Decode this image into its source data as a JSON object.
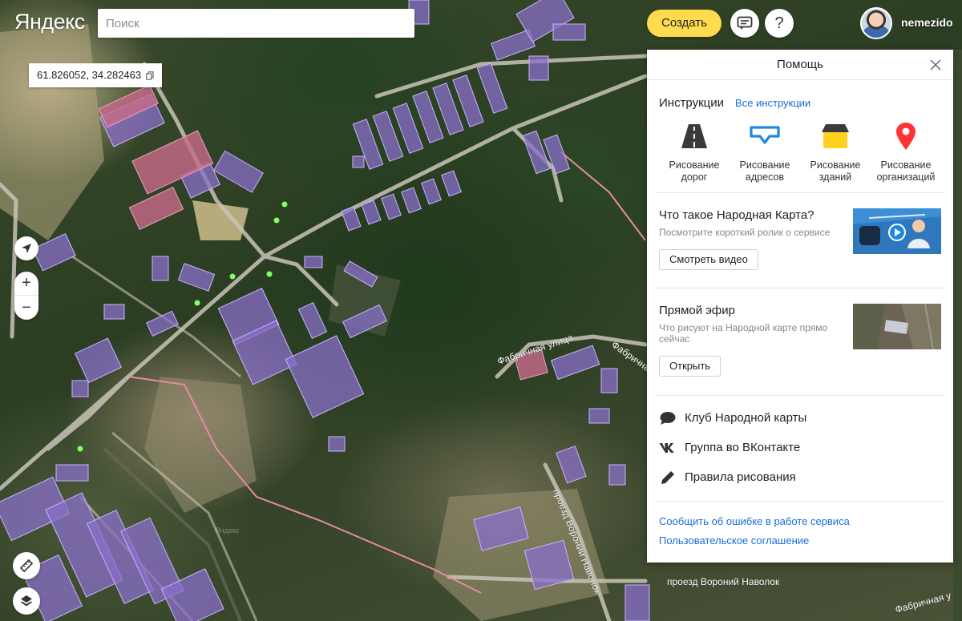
{
  "header": {
    "logo": "Яндекс",
    "search_placeholder": "Поиск",
    "create_label": "Создать",
    "help_label": "?",
    "username": "nemezido"
  },
  "coordinates": {
    "value": "61.826052, 34.282463"
  },
  "zoom": {
    "plus": "+",
    "minus": "−"
  },
  "map_labels": {
    "street_fabrichnaya_1": "Фабричная улица",
    "street_fabrichnaya_2": "Фабричная",
    "street_fabrichnaya_3": "Фабричная у",
    "proezd_vertical": "проезд Вороний Наволок",
    "proezd_horizontal": "проезд Вороний Наволок",
    "watermark": "Яндекс"
  },
  "help_panel": {
    "title": "Помощь",
    "instructions": {
      "title": "Инструкции",
      "all_link": "Все инструкции",
      "tools": [
        {
          "icon": "road-icon",
          "line1": "Рисование",
          "line2": "дорог"
        },
        {
          "icon": "address-icon",
          "line1": "Рисование",
          "line2": "адресов"
        },
        {
          "icon": "building-icon",
          "line1": "Рисование",
          "line2": "зданий"
        },
        {
          "icon": "pin-icon",
          "line1": "Рисование",
          "line2": "организаций"
        }
      ]
    },
    "video_card": {
      "title": "Что такое Народная Карта?",
      "subtitle": "Посмотрите короткий ролик о сервисе",
      "button": "Смотреть видео"
    },
    "live_card": {
      "title": "Прямой эфир",
      "subtitle": "Что рисуют на Народной карте прямо сейчас",
      "button": "Открыть"
    },
    "links": [
      {
        "icon": "chat-icon",
        "label": "Клуб Народной карты"
      },
      {
        "icon": "vk-icon",
        "label": "Группа во ВКонтакте"
      },
      {
        "icon": "pencil-icon",
        "label": "Правила рисования"
      }
    ],
    "footer": {
      "report": "Сообщить об ошибке в работе сервиса",
      "agreement": "Пользовательское соглашение"
    }
  },
  "colors": {
    "accent_yellow": "#ffdb4d",
    "link_blue": "#1a6ed8",
    "building_purple": "#8a6fc9",
    "building_pink": "#c86a8a"
  }
}
